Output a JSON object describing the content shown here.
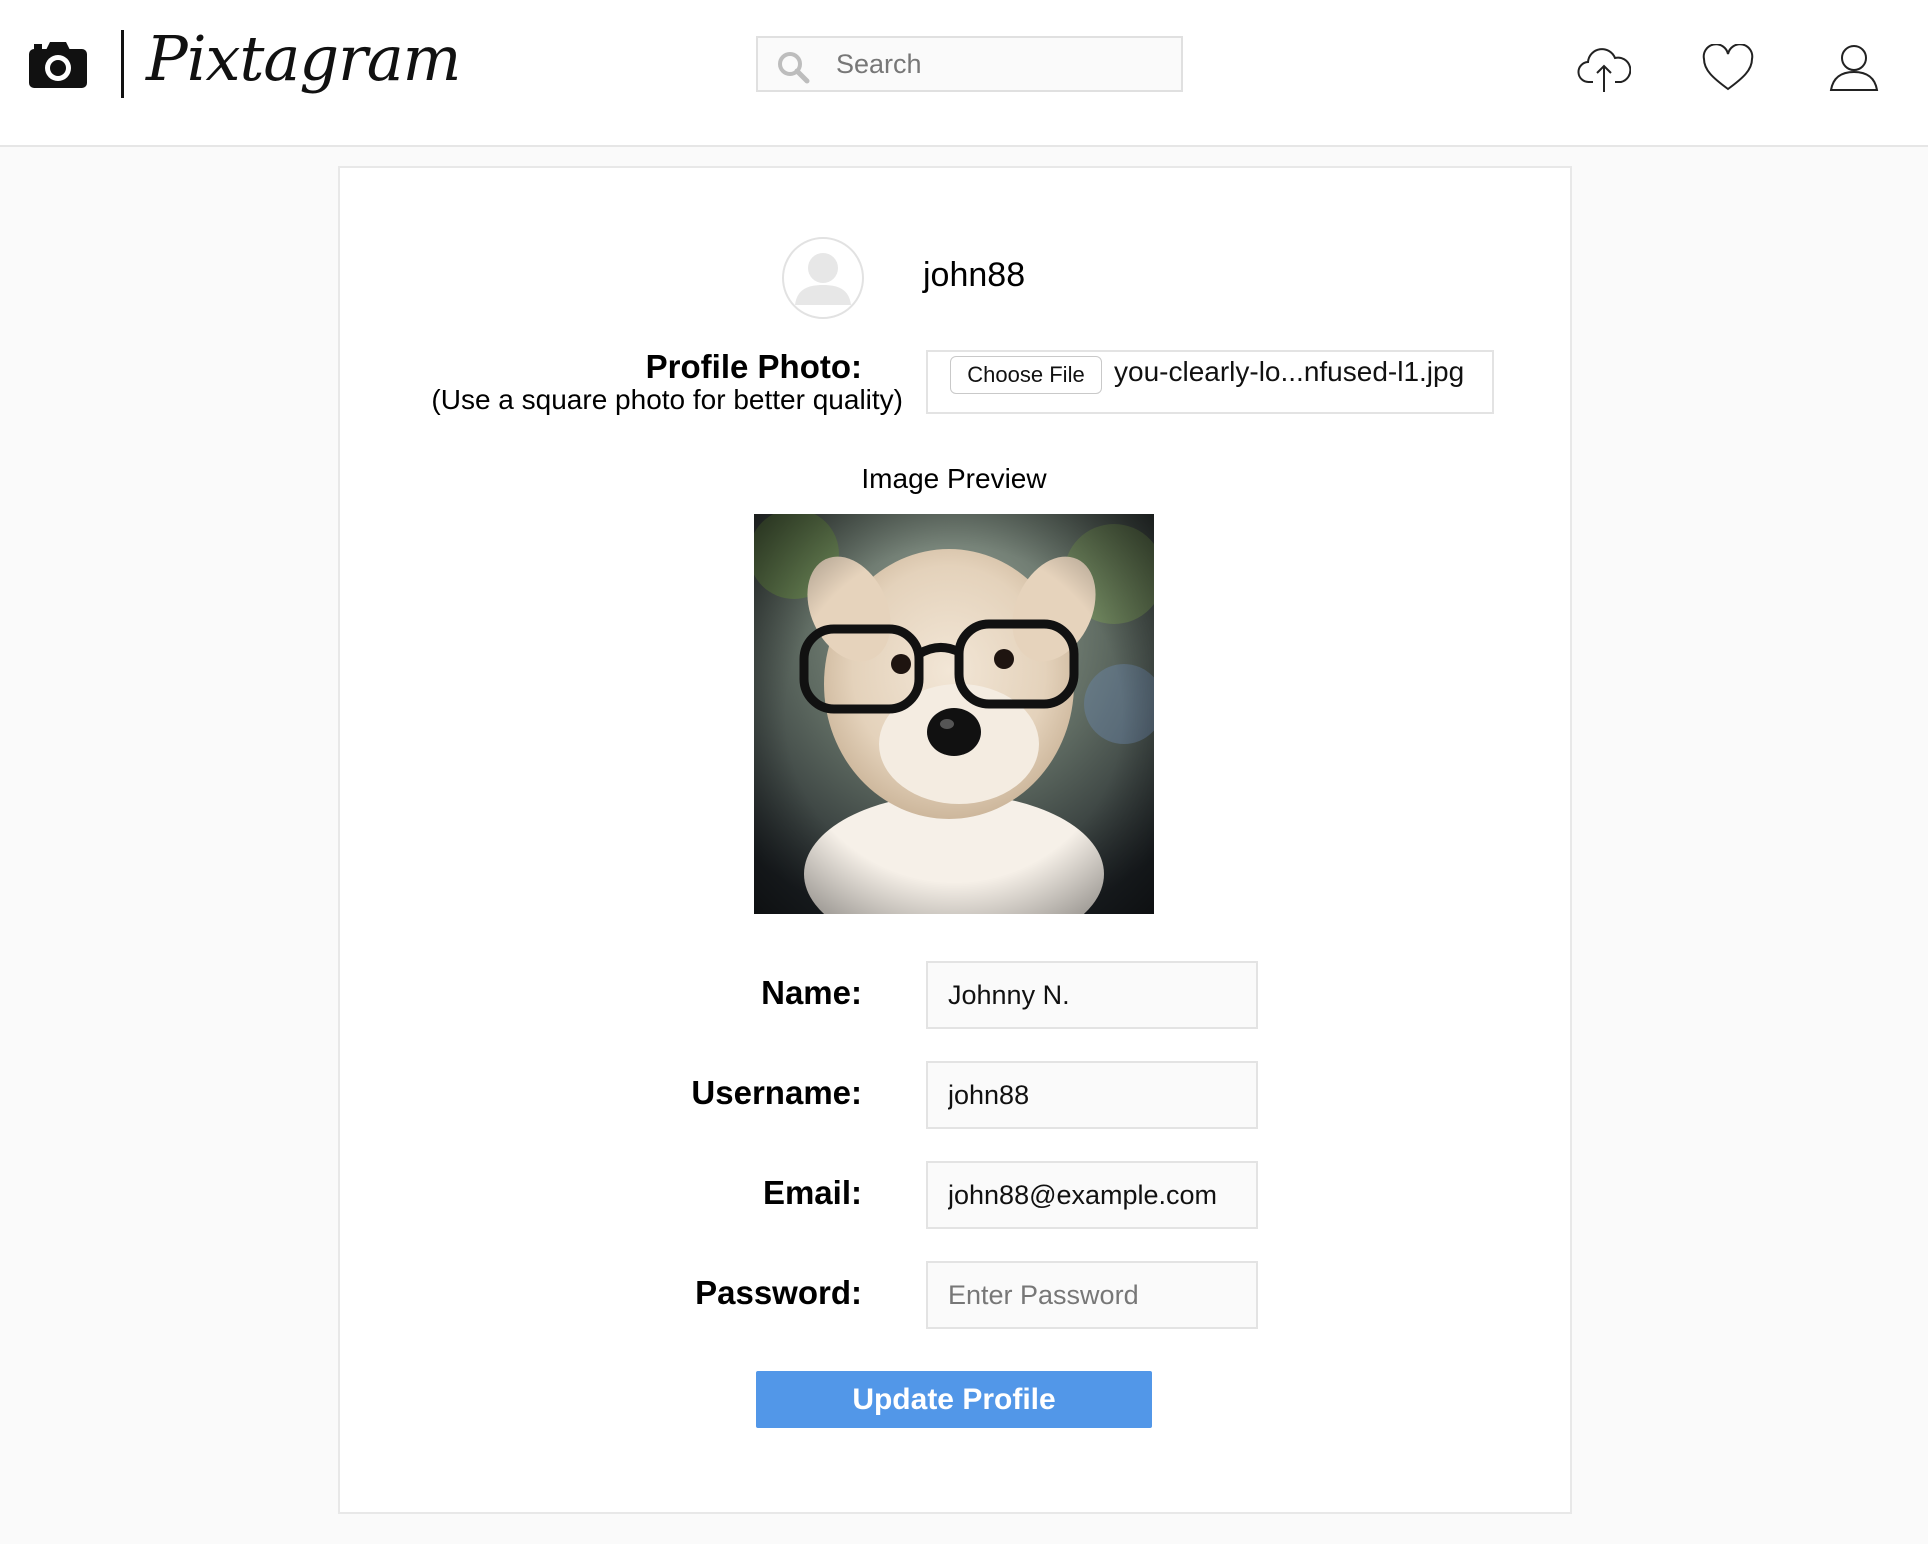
{
  "app": {
    "brand": "Pixtagram"
  },
  "header": {
    "search_placeholder": "Search",
    "icons": [
      "camera-icon",
      "upload-cloud-icon",
      "heart-icon",
      "user-icon"
    ]
  },
  "profile": {
    "username": "john88",
    "photo_label": "Profile Photo:",
    "photo_hint": "(Use a square photo for better quality)",
    "choose_file_label": "Choose File",
    "file_name": "you-clearly-lo...nfused-l1.jpg",
    "preview_title": "Image Preview"
  },
  "form": {
    "name_label": "Name:",
    "name_value": "Johnny N.",
    "username_label": "Username:",
    "username_value": "john88",
    "email_label": "Email:",
    "email_value": "john88@example.com",
    "password_label": "Password:",
    "password_placeholder": "Enter Password",
    "submit_label": "Update Profile"
  },
  "colors": {
    "accent": "#5297e8",
    "background": "#fafafa"
  }
}
